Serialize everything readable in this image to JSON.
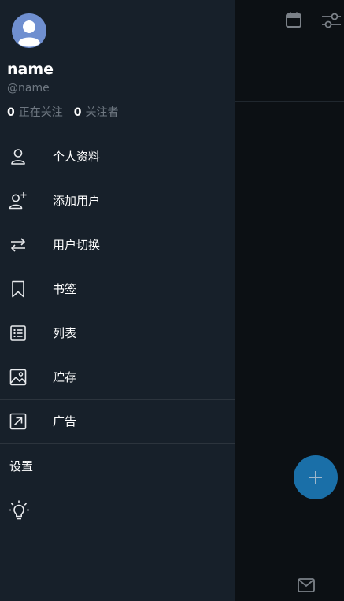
{
  "profile": {
    "name": "name",
    "handle": "@name",
    "following_count": "0",
    "following_label": "正在关注",
    "followers_count": "0",
    "followers_label": "关注者"
  },
  "menu": {
    "items": [
      {
        "label": "个人资料",
        "icon": "person-icon"
      },
      {
        "label": "添加用户",
        "icon": "add-user-icon"
      },
      {
        "label": "用户切换",
        "icon": "swap-icon"
      },
      {
        "label": "书签",
        "icon": "bookmark-icon"
      },
      {
        "label": "列表",
        "icon": "list-icon"
      },
      {
        "label": "贮存",
        "icon": "image-icon"
      },
      {
        "label": "广告",
        "icon": "external-link-icon"
      }
    ],
    "settings_label": "设置"
  },
  "background": {
    "icons": [
      "calendar-icon",
      "tune-icon",
      "compose-plus-icon",
      "mail-icon"
    ]
  },
  "colors": {
    "drawer_bg": "#17202a",
    "scrim_bg": "#0c1014",
    "fab": "#1a6fa8",
    "secondary_text": "#6e7781"
  }
}
